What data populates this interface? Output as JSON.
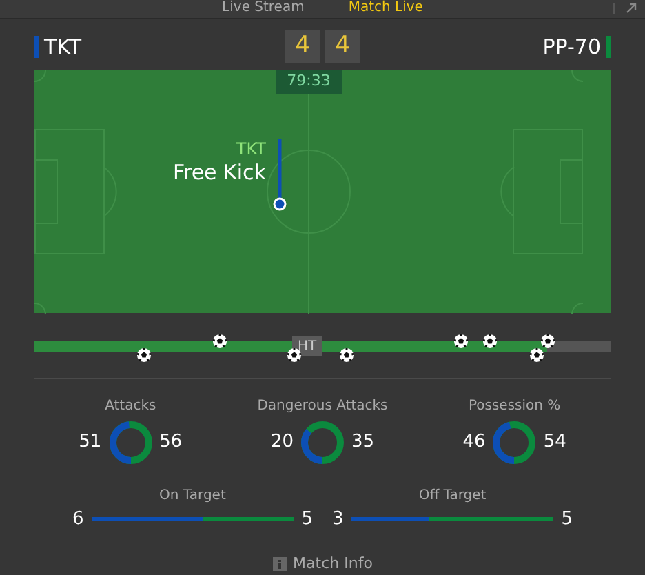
{
  "tabs": [
    {
      "label": "Live Stream",
      "selected": false
    },
    {
      "label": "Match Live",
      "selected": true
    }
  ],
  "home": {
    "name": "TKT",
    "score": "4",
    "color": "#0d4fb5"
  },
  "away": {
    "name": "PP-70",
    "score": "4",
    "color": "#0b8a3e"
  },
  "clock": "79:33",
  "event": {
    "team": "TKT",
    "title": "Free Kick"
  },
  "timeline": {
    "level": 0.89,
    "half_label": "HT",
    "goals": [
      {
        "kind": "home",
        "level": 0.19
      },
      {
        "kind": "away",
        "level": 0.32
      },
      {
        "kind": "home",
        "level": 0.45
      },
      {
        "kind": "home",
        "level": 0.54
      },
      {
        "kind": "away",
        "level": 0.74
      },
      {
        "kind": "away",
        "level": 0.79
      },
      {
        "kind": "home",
        "level": 0.87
      },
      {
        "kind": "away",
        "level": 0.89
      }
    ]
  },
  "ring_stats": [
    {
      "label": "Attacks",
      "home": "51",
      "away": "56",
      "level": 0.48
    },
    {
      "label": "Dangerous Attacks",
      "home": "20",
      "away": "35",
      "level": 0.36
    },
    {
      "label": "Possession %",
      "home": "46",
      "away": "54",
      "level": 0.46
    }
  ],
  "bar_stats": [
    {
      "label": "On Target",
      "home": "6",
      "away": "5",
      "level": 0.55
    },
    {
      "label": "Off Target",
      "home": "3",
      "away": "5",
      "level": 0.38
    }
  ],
  "footer": "Match Info"
}
